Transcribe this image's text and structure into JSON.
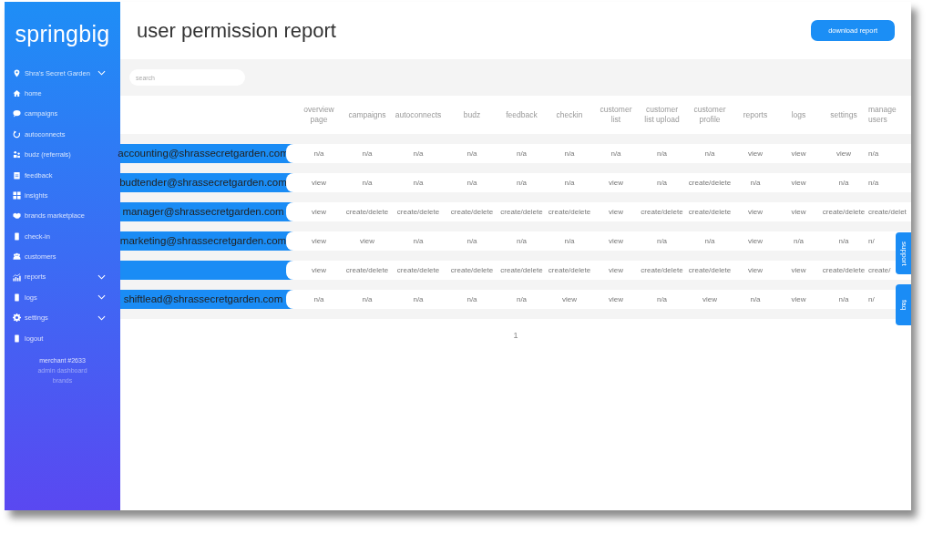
{
  "sidebar": {
    "logo": "springbig",
    "location": {
      "label": "Shra's Secret Garden",
      "expandable": true
    },
    "items": [
      {
        "label": "home",
        "expandable": false
      },
      {
        "label": "campaigns",
        "expandable": false
      },
      {
        "label": "autoconnects",
        "expandable": false
      },
      {
        "label": "budz (referrals)",
        "expandable": false
      },
      {
        "label": "feedback",
        "expandable": false
      },
      {
        "label": "insights",
        "expandable": false
      },
      {
        "label": "brands marketplace",
        "expandable": false
      },
      {
        "label": "check-in",
        "expandable": false
      },
      {
        "label": "customers",
        "expandable": false
      },
      {
        "label": "reports",
        "expandable": true
      },
      {
        "label": "logs",
        "expandable": true
      },
      {
        "label": "settings",
        "expandable": true
      },
      {
        "label": "logout",
        "expandable": false
      }
    ],
    "footer": [
      "merchant #2633",
      "admin dashboard",
      "brands"
    ]
  },
  "page": {
    "title": "user permission report",
    "download_button": "download report",
    "search": {
      "placeholder": "search"
    }
  },
  "table": {
    "columns": [
      "overview page",
      "campaigns",
      "autoconnects",
      "budz",
      "feedback",
      "checkin",
      "customer list",
      "customer list upload",
      "customer profile",
      "reports",
      "logs",
      "settings",
      "manage users"
    ],
    "rows": [
      {
        "user": "accounting@shrassecretgarden.com",
        "cells": [
          "n/a",
          "n/a",
          "n/a",
          "n/a",
          "n/a",
          "n/a",
          "n/a",
          "n/a",
          "n/a",
          "view",
          "view",
          "view",
          "n/a"
        ]
      },
      {
        "user": "budtender@shrassecretgarden.com",
        "cells": [
          "view",
          "n/a",
          "n/a",
          "n/a",
          "n/a",
          "n/a",
          "view",
          "n/a",
          "create/delete",
          "n/a",
          "view",
          "n/a",
          "n/a"
        ]
      },
      {
        "user": "manager@shrassecretgarden.com",
        "cells": [
          "view",
          "create/delete",
          "create/delete",
          "create/delete",
          "create/delete",
          "create/delete",
          "view",
          "create/delete",
          "create/delete",
          "view",
          "view",
          "create/delete",
          "create/delet"
        ]
      },
      {
        "user": "marketing@shrassecretgarden.com",
        "cells": [
          "view",
          "view",
          "n/a",
          "n/a",
          "n/a",
          "n/a",
          "view",
          "n/a",
          "n/a",
          "view",
          "n/a",
          "n/a",
          "n/"
        ]
      },
      {
        "cells": [
          "view",
          "create/delete",
          "create/delete",
          "create/delete",
          "create/delete",
          "create/delete",
          "view",
          "create/delete",
          "create/delete",
          "view",
          "view",
          "create/delete",
          "create/"
        ]
      },
      {
        "user": "shiftlead@shrassecretgarden.com",
        "cells": [
          "n/a",
          "n/a",
          "n/a",
          "n/a",
          "n/a",
          "view",
          "view",
          "n/a",
          "view",
          "n/a",
          "view",
          "n/a",
          "n/"
        ]
      }
    ],
    "pages": [
      "1"
    ]
  },
  "side_tabs": [
    "support",
    "faq"
  ]
}
